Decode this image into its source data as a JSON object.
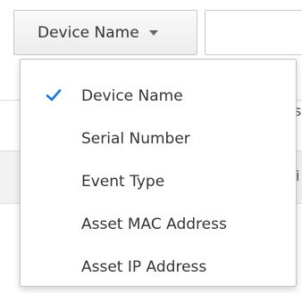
{
  "filter": {
    "selected_label": "Device Name",
    "caret_icon": "caret-down-icon"
  },
  "search": {
    "value": ""
  },
  "menu": {
    "check_icon": "check-icon",
    "check_color": "#1a7ad8",
    "items": [
      {
        "label": "Device Name",
        "selected": true
      },
      {
        "label": "Serial Number",
        "selected": false
      },
      {
        "label": "Event Type",
        "selected": false
      },
      {
        "label": "Asset MAC Address",
        "selected": false
      },
      {
        "label": "Asset IP Address",
        "selected": false
      }
    ]
  }
}
